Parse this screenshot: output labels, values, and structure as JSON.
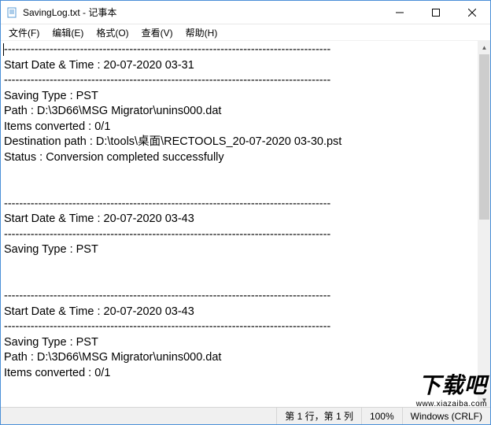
{
  "window": {
    "title": "SavingLog.txt - 记事本"
  },
  "menu": {
    "file": "文件(F)",
    "edit": "编辑(E)",
    "format": "格式(O)",
    "view": "查看(V)",
    "help": "帮助(H)"
  },
  "content": {
    "text": "--------------------------------------------------------------------------------------\nStart Date & Time : 20-07-2020 03-31\n--------------------------------------------------------------------------------------\nSaving Type : PST\nPath : D:\\3D66\\MSG Migrator\\unins000.dat\nItems converted : 0/1\nDestination path : D:\\tools\\桌面\\RECTOOLS_20-07-2020 03-30.pst\nStatus : Conversion completed successfully\n\n\n--------------------------------------------------------------------------------------\nStart Date & Time : 20-07-2020 03-43\n--------------------------------------------------------------------------------------\nSaving Type : PST\n\n\n--------------------------------------------------------------------------------------\nStart Date & Time : 20-07-2020 03-43\n--------------------------------------------------------------------------------------\nSaving Type : PST\nPath : D:\\3D66\\MSG Migrator\\unins000.dat\nItems converted : 0/1"
  },
  "statusbar": {
    "position": "第 1 行，第 1 列",
    "zoom": "100%",
    "lineending": "Windows (CRLF)"
  },
  "watermark": {
    "brand": "下载吧",
    "url": "www.xiazaiba.com"
  }
}
